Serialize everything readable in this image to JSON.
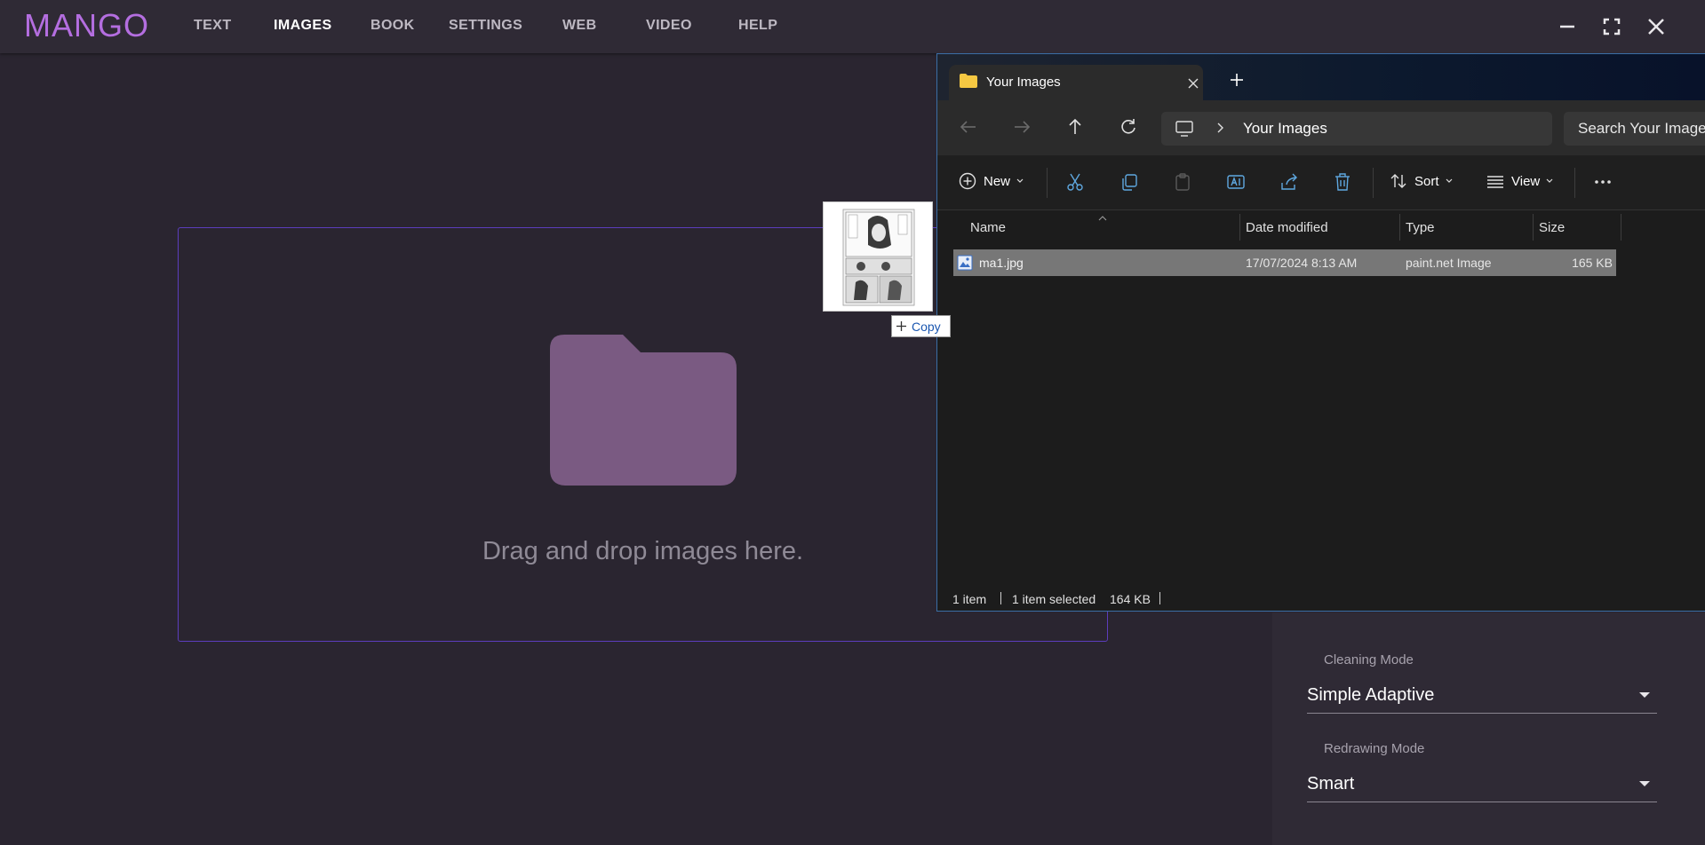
{
  "app": {
    "logo": "MANGO",
    "nav": [
      "TEXT",
      "IMAGES",
      "BOOK",
      "SETTINGS",
      "WEB",
      "VIDEO",
      "HELP"
    ],
    "active_nav": "IMAGES",
    "accent_color": "#b46ee0"
  },
  "dropzone": {
    "text": "Drag and drop images here.",
    "icon": "folder-icon"
  },
  "settings": {
    "cleaning_label": "Cleaning Mode",
    "cleaning_value": "Simple Adaptive",
    "redrawing_label": "Redrawing Mode",
    "redrawing_value": "Smart"
  },
  "explorer": {
    "tab_title": "Your Images",
    "path_segment": "Your Images",
    "search_placeholder": "Search Your Images",
    "toolbar": {
      "new_label": "New",
      "sort_label": "Sort",
      "view_label": "View"
    },
    "columns": {
      "name": "Name",
      "date": "Date modified",
      "type": "Type",
      "size": "Size"
    },
    "files": [
      {
        "name": "ma1.jpg",
        "date": "17/07/2024 8:13 AM",
        "type": "paint.net Image",
        "size": "165 KB"
      }
    ],
    "status": {
      "count": "1 item",
      "selected": "1 item selected",
      "selected_size": "164 KB"
    }
  },
  "drag": {
    "badge_label": "Copy"
  }
}
